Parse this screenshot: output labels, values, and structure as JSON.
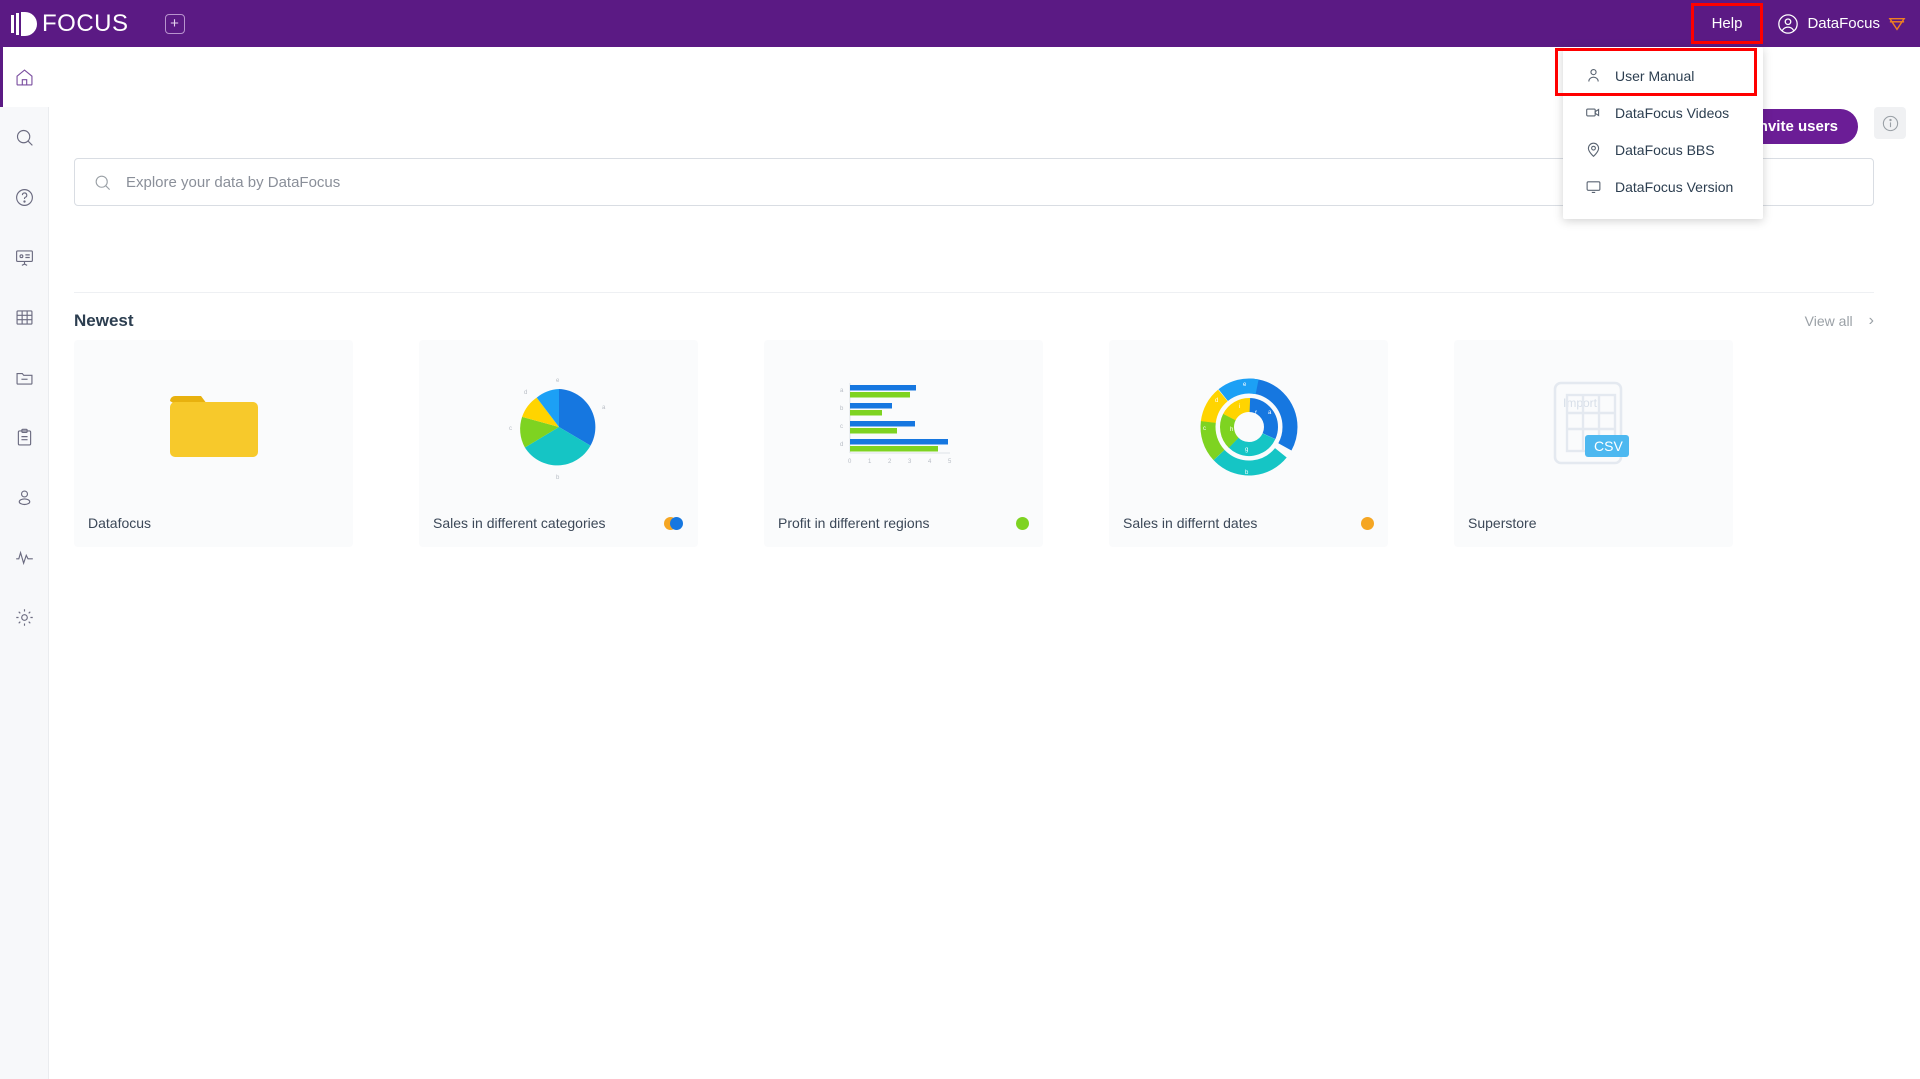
{
  "brand": {
    "name": "FOCUS",
    "add_tab_icon": "plus-square-icon"
  },
  "topbar": {
    "help_label": "Help",
    "user_name": "DataFocus",
    "avatar_icon": "user-circle-icon",
    "gem_icon": "diamond-icon",
    "highlight_color": "#FF0000",
    "background": "#5B1A84"
  },
  "help_menu": {
    "items": [
      {
        "label": "User Manual",
        "icon": "person-icon",
        "highlighted": true
      },
      {
        "label": "DataFocus Videos",
        "icon": "video-camera-icon",
        "highlighted": false
      },
      {
        "label": "DataFocus BBS",
        "icon": "location-pin-icon",
        "highlighted": false
      },
      {
        "label": "DataFocus Version",
        "icon": "monitor-icon",
        "highlighted": false
      }
    ]
  },
  "sidebar": {
    "items": [
      {
        "icon": "home-icon",
        "name": "home",
        "active": true
      },
      {
        "icon": "search-icon",
        "name": "search",
        "active": false
      },
      {
        "icon": "question-circle-icon",
        "name": "help",
        "active": false
      },
      {
        "icon": "presentation-icon",
        "name": "dashboard",
        "active": false
      },
      {
        "icon": "table-grid-icon",
        "name": "tables",
        "active": false
      },
      {
        "icon": "folder-icon",
        "name": "folder",
        "active": false
      },
      {
        "icon": "clipboard-icon",
        "name": "tasks",
        "active": false
      },
      {
        "icon": "person-icon",
        "name": "users",
        "active": false
      },
      {
        "icon": "pulse-icon",
        "name": "monitoring",
        "active": false
      },
      {
        "icon": "gear-icon",
        "name": "settings",
        "active": false
      }
    ]
  },
  "search": {
    "placeholder": "Explore your data by DataFocus",
    "icon": "search-icon",
    "value": ""
  },
  "actions": {
    "invite_label": "Invite users",
    "info_icon": "info-circle-icon"
  },
  "section": {
    "title": "Newest",
    "view_all_label": "View all",
    "chevron": "›"
  },
  "cards": [
    {
      "label": "Datafocus",
      "thumb": "folder-thumb",
      "dot": null
    },
    {
      "label": "Sales in different categories",
      "thumb": "pie-chart-thumb",
      "dot": "pair-orange-blue"
    },
    {
      "label": "Profit in different regions",
      "thumb": "bar-chart-thumb",
      "dot": "#7ED321"
    },
    {
      "label": "Sales in differnt dates",
      "thumb": "donut-chart-thumb",
      "dot": "#F5A623"
    },
    {
      "label": "Superstore",
      "thumb": "csv-import-thumb",
      "dot": null
    }
  ],
  "chart_data": [
    {
      "type": "pie",
      "title": "Sales in different categories",
      "categories": [
        "a",
        "b",
        "c",
        "d",
        "e"
      ],
      "values": [
        33,
        27,
        14,
        12,
        14
      ],
      "colors": [
        "#1677E0",
        "#15C5C5",
        "#7ED321",
        "#FFD400",
        "#1CA0F5"
      ],
      "legend": "slice-labels"
    },
    {
      "type": "bar",
      "title": "Profit in different regions",
      "orientation": "horizontal",
      "categories": [
        "a",
        "b",
        "c",
        "d"
      ],
      "series": [
        {
          "name": "blue",
          "values": [
            3.3,
            2.1,
            3.25,
            4.9
          ],
          "color": "#1677E0"
        },
        {
          "name": "green",
          "values": [
            3.0,
            1.6,
            2.35,
            4.4
          ],
          "color": "#7ED321"
        }
      ],
      "xlabel": "",
      "ylabel": "",
      "xlim": [
        0,
        5
      ],
      "xticks": [
        "0",
        "1",
        "2",
        "3",
        "4",
        "5"
      ],
      "grid": false
    },
    {
      "type": "pie",
      "title": "Sales in differnt dates",
      "subtype": "nested-donut",
      "outer": {
        "categories": [
          "a",
          "b",
          "c",
          "d",
          "e"
        ],
        "values": [
          33,
          27,
          14,
          12,
          14
        ],
        "colors": [
          "#1677E0",
          "#15C5C5",
          "#7ED321",
          "#FFD400",
          "#1CA0F5"
        ]
      },
      "inner": {
        "categories": [
          "f",
          "g",
          "h",
          "i"
        ],
        "values": [
          32,
          30,
          20,
          18
        ],
        "colors": [
          "#1677E0",
          "#15C5C5",
          "#7ED321",
          "#FFD400"
        ]
      }
    }
  ],
  "csv_thumb": {
    "import_label": "Import",
    "badge_label": "CSV",
    "badge_color": "#4DB8F0"
  }
}
